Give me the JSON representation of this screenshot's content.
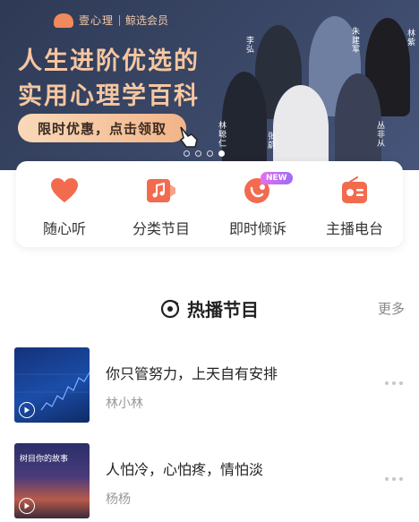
{
  "banner": {
    "brand": "壹心理",
    "brand_sub": "鲸选会员",
    "headline_1": "人生进阶优选的",
    "headline_2": "实用心理学百科",
    "promo_button": "限时优惠，点击领取",
    "people": [
      "李弘",
      "朱建军",
      "林紫",
      "林聪仁",
      "张蔚",
      "丛非从"
    ],
    "slide_count": 4,
    "active_slide": 4
  },
  "nav": [
    {
      "label": "随心听",
      "icon": "heart-icon"
    },
    {
      "label": "分类节目",
      "icon": "music-note-icon"
    },
    {
      "label": "即时倾诉",
      "icon": "chat-bubble-icon",
      "badge": "NEW"
    },
    {
      "label": "主播电台",
      "icon": "radio-icon"
    }
  ],
  "section": {
    "title": "热播节目",
    "more": "更多"
  },
  "programs": [
    {
      "title": "你只管努力，上天自有安排",
      "author": "林小林"
    },
    {
      "title": "人怕冷，心怕疼，情怕淡",
      "author": "杨杨",
      "thumb_caption": "树目你的故事"
    }
  ],
  "colors": {
    "accent": "#f26b4f",
    "banner_bg": "#3b4868",
    "promo": "#f2b489",
    "badge": "#b46cf2"
  }
}
